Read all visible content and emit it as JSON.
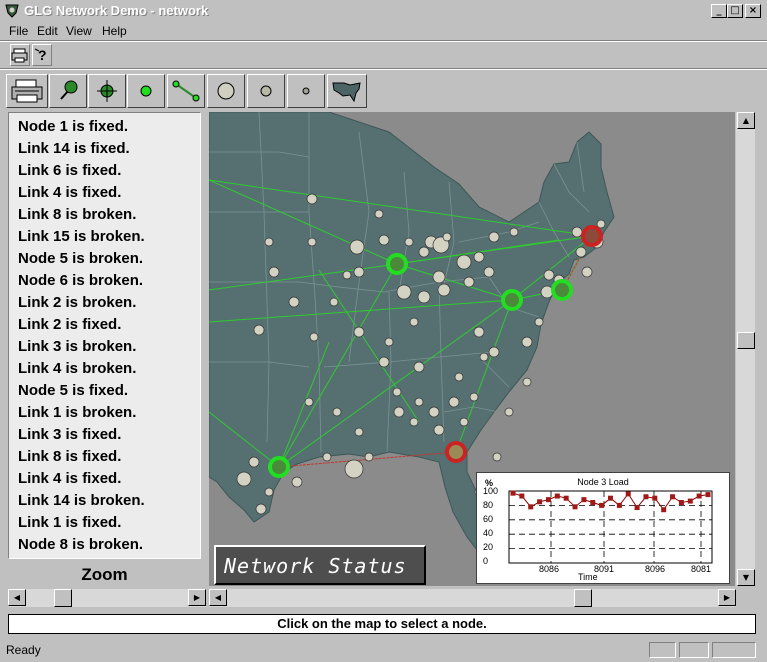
{
  "window": {
    "title": "GLG Network Demo - network",
    "minimize": "_",
    "maximize": "□",
    "close": "×"
  },
  "menu": [
    "File",
    "Edit",
    "View",
    "Help"
  ],
  "messages": [
    "Node 1 is fixed.",
    "Link 14 is fixed.",
    "Link 6 is fixed.",
    "Link 4 is fixed.",
    "Link 8 is broken.",
    "Link 15 is broken.",
    "Node 5 is broken.",
    "Node 6 is broken.",
    "Link 2 is broken.",
    "Link 2 is fixed.",
    "Link 3 is broken.",
    "Link 4 is broken.",
    "Node 5 is fixed.",
    "Link 1 is broken.",
    "Link 3 is fixed.",
    "Link 8 is fixed.",
    "Link 4 is fixed.",
    "Link 14 is broken.",
    "Link 1 is fixed.",
    "Node 8 is broken."
  ],
  "zoom_label": "Zoom",
  "network_status_label": "Network Status",
  "click_message": "Click on the map to select a node.",
  "status": "Ready",
  "colors": {
    "map_land": "#567072",
    "map_background": "#8b8b8b",
    "link_ok": "#2ecc2e",
    "link_broken": "#c0392b",
    "node_ok_ring": "#22dd22",
    "node_broken_ring": "#cc2222"
  },
  "chart_data": {
    "type": "line",
    "title": "Node 3 Load",
    "ylabel": "%",
    "xlabel": "Time",
    "ylim": [
      0,
      100
    ],
    "y_ticks": [
      "100",
      "80",
      "60",
      "40",
      "20",
      "0"
    ],
    "x_ticks": [
      "8086",
      "8091",
      "8096",
      "8081"
    ],
    "series": [
      {
        "values": [
          97,
          93,
          78,
          85,
          88,
          93,
          90,
          78,
          88,
          84,
          80,
          90,
          80,
          96,
          77,
          92,
          90,
          74,
          92,
          84,
          86,
          93,
          95
        ]
      }
    ]
  }
}
